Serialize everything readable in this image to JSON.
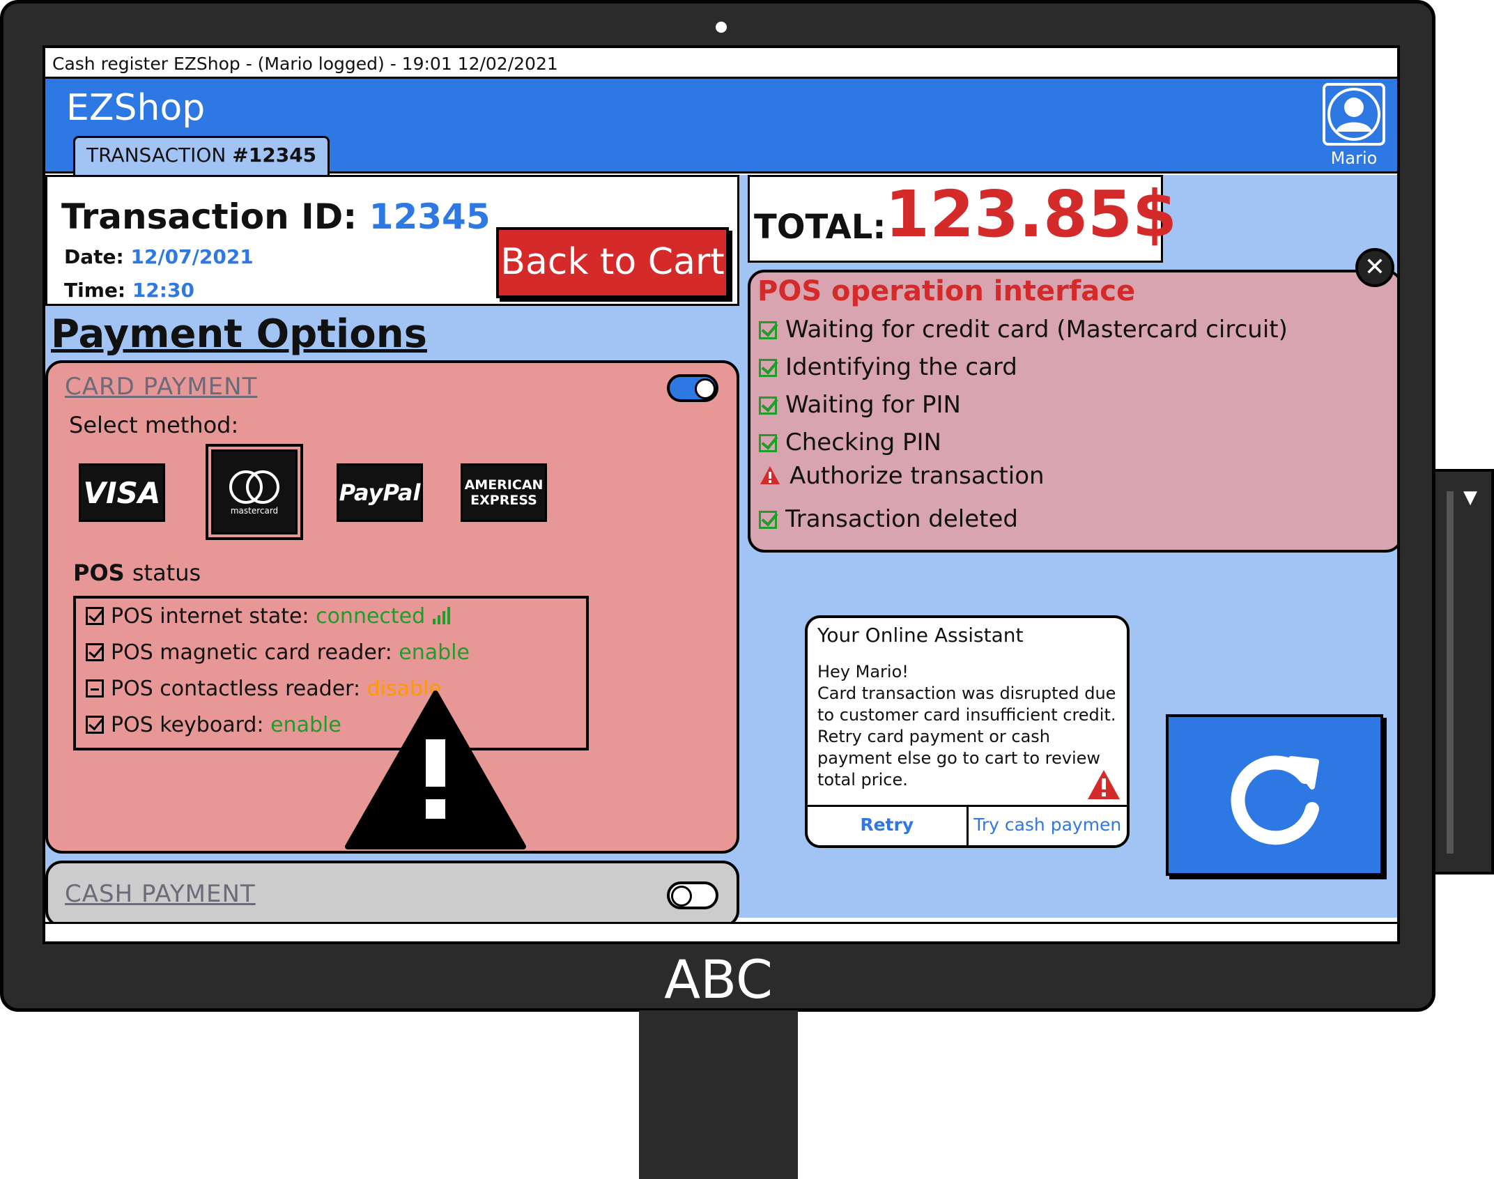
{
  "window": {
    "title": "Cash register EZShop - (Mario logged) - 19:01 12/02/2021"
  },
  "header": {
    "logo": "EZShop",
    "tab_prefix": "TRANSACTION",
    "tab_number": "#12345",
    "user_name": "Mario"
  },
  "transaction": {
    "id_label": "Transaction ID:",
    "id_value": "12345",
    "date_label": "Date:",
    "date_value": "12/07/2021",
    "time_label": "Time:",
    "time_value": "12:30",
    "back_button": "Back to Cart"
  },
  "payment": {
    "title": "Payment Options",
    "card": {
      "label": "CARD PAYMENT",
      "toggle_on": true,
      "select_method": "Select method:",
      "methods": [
        "VISA",
        "mastercard",
        "PayPal",
        "AMERICAN",
        "EXPRESS"
      ],
      "selected_method": "mastercard",
      "pos_status_title": "POS",
      "pos_status_rest": "status",
      "pos_lines": [
        {
          "label": "POS internet state:",
          "value": "connected",
          "state": "checked"
        },
        {
          "label": "POS magnetic card reader:",
          "value": "enable",
          "state": "checked"
        },
        {
          "label": "POS contactless reader:",
          "value": "disable",
          "state": "indeterminate"
        },
        {
          "label": "POS keyboard:",
          "value": "enable",
          "state": "checked"
        }
      ]
    },
    "cash": {
      "label": "CASH PAYMENT",
      "toggle_on": false
    }
  },
  "total": {
    "label": "TOTAL:",
    "value": "123.85$"
  },
  "pos_operation": {
    "title": "POS operation interface",
    "steps": [
      {
        "text": "Waiting for credit card (Mastercard circuit)",
        "status": "done"
      },
      {
        "text": "Identifying the card",
        "status": "done"
      },
      {
        "text": "Waiting for PIN",
        "status": "done"
      },
      {
        "text": "Checking PIN",
        "status": "done"
      },
      {
        "text": "Authorize transaction",
        "status": "warning"
      },
      {
        "text": "Transaction deleted",
        "status": "done"
      }
    ]
  },
  "assistant": {
    "title": "Your Online Assistant",
    "message": "Hey Mario!\nCard transaction was disrupted due to customer card insufficient credit. Retry card payment or cash payment else go to cart to review total price.",
    "retry": "Retry",
    "try_cash": "Try cash paymen"
  },
  "monitor": {
    "brand": "ABC"
  },
  "icons": {
    "refresh": "refresh-icon",
    "warning": "warning-icon",
    "close": "close-icon",
    "avatar": "user-icon",
    "check": "check-icon"
  },
  "colors": {
    "header_blue": "#2e78e3",
    "workspace_blue": "#a2c4f5",
    "card_panel": "#e89797",
    "pos_panel": "#d8a4b0",
    "alert_red": "#d42a2a",
    "ok_green": "#1f9c2a",
    "warn_orange": "#ff9900",
    "cash_panel": "#cccccc"
  }
}
